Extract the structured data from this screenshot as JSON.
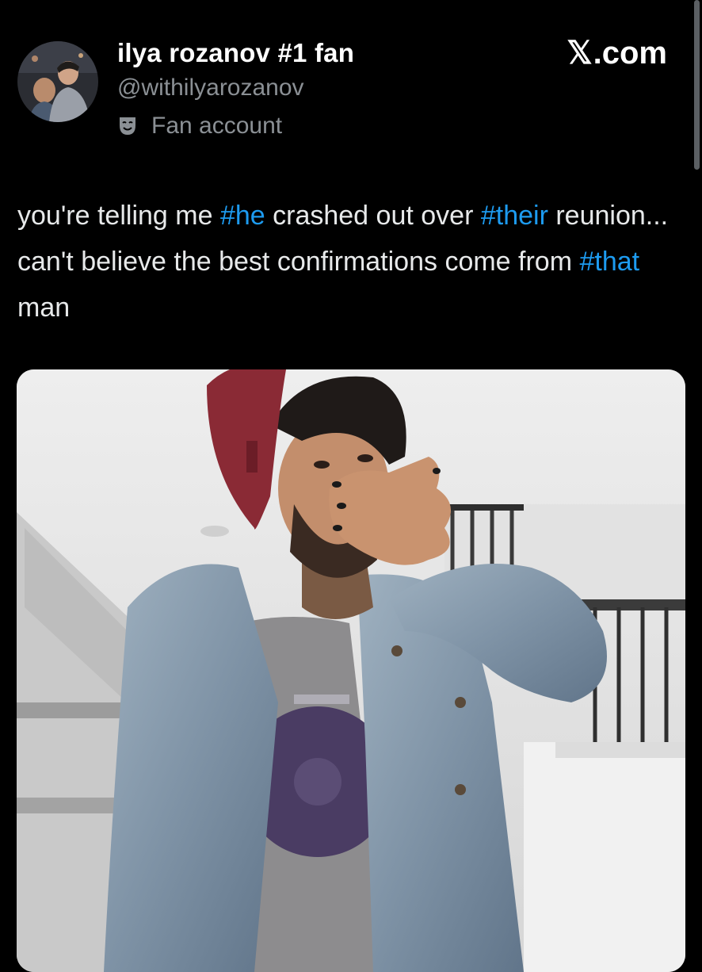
{
  "post": {
    "author": {
      "display_name": "ilya rozanov #1 fan",
      "handle": "@withilyarozanov",
      "label": "Fan account",
      "label_icon": "theater-masks-icon"
    },
    "brand": {
      "glyph": "𝕏",
      "text": ".com"
    },
    "text_segments": [
      {
        "text": "you're telling me ",
        "type": "text"
      },
      {
        "text": "#he",
        "type": "hashtag"
      },
      {
        "text": " crashed out over ",
        "type": "text"
      },
      {
        "text": "#their",
        "type": "hashtag"
      },
      {
        "text": " reunion... can't believe the best confirmations come from ",
        "type": "text"
      },
      {
        "text": "#that",
        "type": "hashtag"
      },
      {
        "text": " man",
        "type": "text"
      }
    ],
    "media": {
      "kind": "photo"
    }
  },
  "colors": {
    "background": "#000000",
    "primary_text": "#e7e9ea",
    "secondary_text": "#8b9095",
    "hashtag": "#1d9bf0"
  }
}
